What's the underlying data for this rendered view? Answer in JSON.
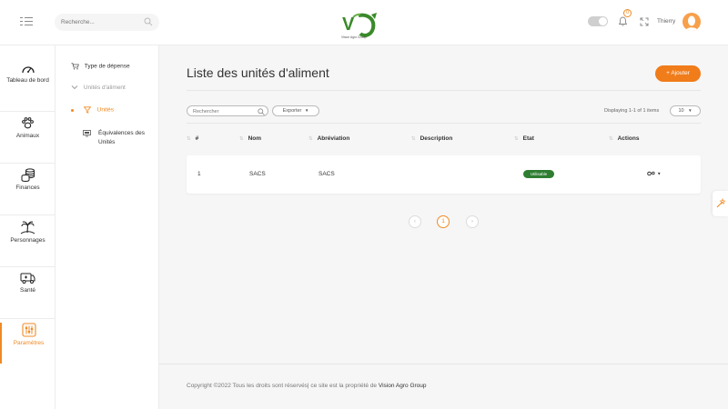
{
  "header": {
    "search_placeholder": "Recherche...",
    "logo_text": "Vision Agro Group",
    "notification_count": "0",
    "username": "Thierry"
  },
  "sidebar": {
    "items": [
      {
        "label": "Tableau de bord",
        "icon": "gauge-icon"
      },
      {
        "label": "Animaux",
        "icon": "paw-icon"
      },
      {
        "label": "Finances",
        "icon": "coins-icon"
      },
      {
        "label": "Personnages",
        "icon": "island-icon"
      },
      {
        "label": "Santé",
        "icon": "ambulance-icon"
      },
      {
        "label": "Paramètres",
        "icon": "sliders-icon"
      }
    ],
    "active": "Paramètres"
  },
  "submenu": {
    "items": [
      {
        "label": "Type de dépense",
        "icon": "cart-icon"
      },
      {
        "label": "Unités d'aliment",
        "icon": "chevron-down-icon"
      },
      {
        "label": "Unités",
        "icon": "filter-icon"
      },
      {
        "label": "Équivalences des Unités",
        "icon": "monitor-icon"
      }
    ]
  },
  "main": {
    "title": "Liste des unités d'aliment",
    "add_label": "Ajouter",
    "table_search_placeholder": "Rechercher",
    "export_label": "Exporter",
    "displaying": "Displaying 1-1 of 1 items",
    "per_page": "10",
    "columns": [
      "#",
      "Nom",
      "Abréviation",
      "Description",
      "Etat",
      "Actions"
    ],
    "rows": [
      {
        "num": "1",
        "nom": "SACS",
        "abbr": "SACS",
        "description": "",
        "etat": "Utilisable"
      }
    ],
    "pagination": {
      "current": "1"
    }
  },
  "footer": {
    "text": "Copyright ©2022 Tous les droits sont réservés| ce site est la propriété de",
    "brand": "Vision Agro Group"
  },
  "colors": {
    "accent": "#f07c1a",
    "status_green": "#2e7d32"
  }
}
